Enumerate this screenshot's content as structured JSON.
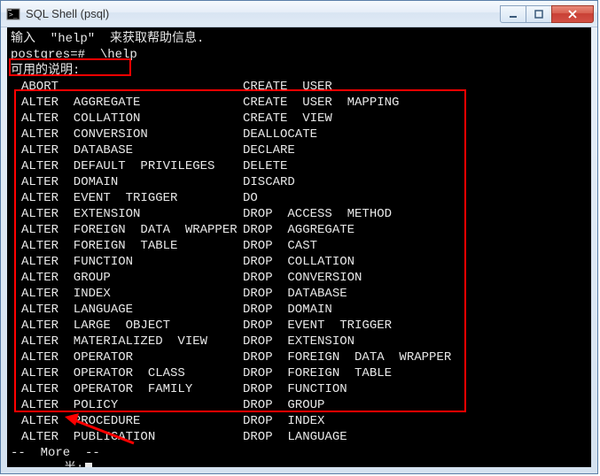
{
  "window": {
    "title": "SQL Shell (psql)"
  },
  "terminal": {
    "intro": "输入  \"help\"  来获取帮助信息.",
    "blank": "",
    "prompt_line": "postgres=#  \\help",
    "avail_label": "可用的说明:",
    "more": "--  More  --",
    "bottom": "半:"
  },
  "commands": {
    "left": [
      "ABORT",
      "ALTER  AGGREGATE",
      "ALTER  COLLATION",
      "ALTER  CONVERSION",
      "ALTER  DATABASE",
      "ALTER  DEFAULT  PRIVILEGES",
      "ALTER  DOMAIN",
      "ALTER  EVENT  TRIGGER",
      "ALTER  EXTENSION",
      "ALTER  FOREIGN  DATA  WRAPPER",
      "ALTER  FOREIGN  TABLE",
      "ALTER  FUNCTION",
      "ALTER  GROUP",
      "ALTER  INDEX",
      "ALTER  LANGUAGE",
      "ALTER  LARGE  OBJECT",
      "ALTER  MATERIALIZED  VIEW",
      "ALTER  OPERATOR",
      "ALTER  OPERATOR  CLASS",
      "ALTER  OPERATOR  FAMILY",
      "ALTER  POLICY",
      "ALTER  PROCEDURE",
      "ALTER  PUBLICATION"
    ],
    "right": [
      "CREATE  USER",
      "CREATE  USER  MAPPING",
      "CREATE  VIEW",
      "DEALLOCATE",
      "DECLARE",
      "DELETE",
      "DISCARD",
      "DO",
      "DROP  ACCESS  METHOD",
      "DROP  AGGREGATE",
      "DROP  CAST",
      "DROP  COLLATION",
      "DROP  CONVERSION",
      "DROP  DATABASE",
      "DROP  DOMAIN",
      "DROP  EVENT  TRIGGER",
      "DROP  EXTENSION",
      "DROP  FOREIGN  DATA  WRAPPER",
      "DROP  FOREIGN  TABLE",
      "DROP  FUNCTION",
      "DROP  GROUP",
      "DROP  INDEX",
      "DROP  LANGUAGE"
    ]
  }
}
